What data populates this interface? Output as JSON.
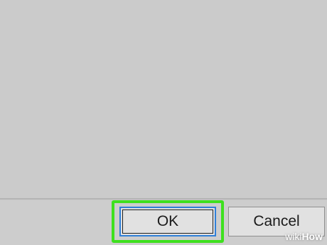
{
  "dialog": {
    "ok_label": "OK",
    "cancel_label": "Cancel"
  },
  "watermark": {
    "wiki": "wiki",
    "how": "How"
  },
  "colors": {
    "highlight": "#3ee01e",
    "focus_border": "#2f7fd8",
    "background": "#cccccc"
  }
}
